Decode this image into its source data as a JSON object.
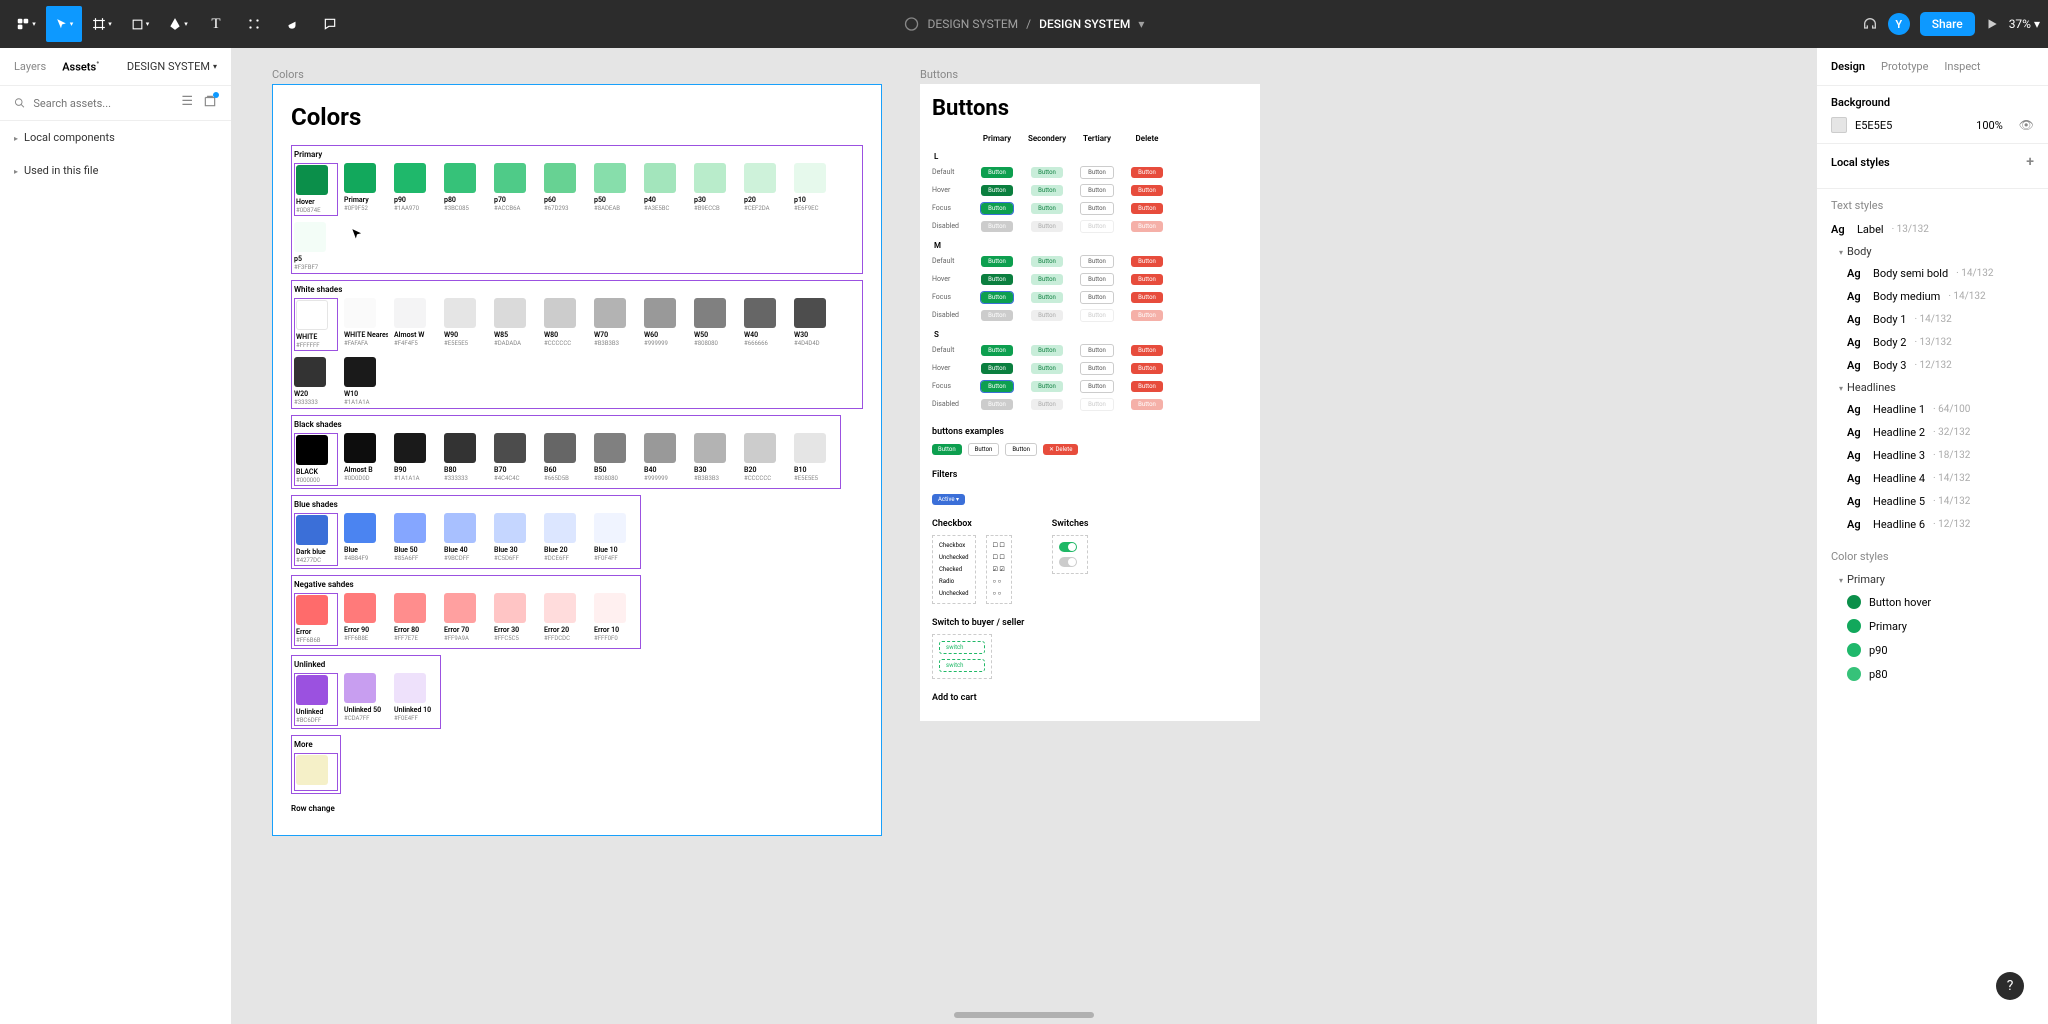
{
  "toolbar": {
    "project": "DESIGN SYSTEM",
    "file": "DESIGN SYSTEM",
    "avatar_letter": "Y",
    "share_label": "Share",
    "zoom": "37%"
  },
  "left_panel": {
    "tabs": {
      "layers": "Layers",
      "assets": "Assets",
      "page": "DESIGN SYSTEM"
    },
    "search_placeholder": "Search assets...",
    "sections": [
      "Local components",
      "Used in this file"
    ]
  },
  "canvas": {
    "colors_frame_label": "Colors",
    "colors_title": "Colors",
    "color_sections": [
      {
        "title": "Primary",
        "swatches": [
          {
            "name": "Hover",
            "hex": "#0D874E",
            "chip": "#0B8F4A"
          },
          {
            "name": "Primary",
            "hex": "#0F9F52",
            "chip": "#12A85C"
          },
          {
            "name": "p90",
            "hex": "#1AA970",
            "chip": "#1FB86B"
          },
          {
            "name": "p80",
            "hex": "#3BC085",
            "chip": "#36C279"
          },
          {
            "name": "p70",
            "hex": "#ACCB6A",
            "chip": "#4FCB88"
          },
          {
            "name": "p60",
            "hex": "#67D293",
            "chip": "#67D293"
          },
          {
            "name": "p50",
            "hex": "#8ADEAB",
            "chip": "#87DEAB"
          },
          {
            "name": "p40",
            "hex": "#A3E5BC",
            "chip": "#A3E5BC"
          },
          {
            "name": "p30",
            "hex": "#B9ECCB",
            "chip": "#B9ECCB"
          },
          {
            "name": "p20",
            "hex": "#CEF2DA",
            "chip": "#CEF2DA"
          },
          {
            "name": "p10",
            "hex": "#E6F9EC",
            "chip": "#E6F9EC"
          },
          {
            "name": "p5",
            "hex": "#F3FBF7",
            "chip": "#F3FDF7"
          }
        ]
      },
      {
        "title": "White shades",
        "swatches": [
          {
            "name": "WHITE",
            "hex": "#FFFFFF",
            "chip": "#FFFFFF"
          },
          {
            "name": "WHITE Nearest",
            "hex": "#FAFAFA",
            "chip": "#FAFAFA"
          },
          {
            "name": "Almost W",
            "hex": "#F4F4F5",
            "chip": "#F4F4F5"
          },
          {
            "name": "W90",
            "hex": "#E5E5E5",
            "chip": "#E5E5E5"
          },
          {
            "name": "W85",
            "hex": "#DADADA",
            "chip": "#DADADA"
          },
          {
            "name": "W80",
            "hex": "#CCCCCC",
            "chip": "#CCCCCC"
          },
          {
            "name": "W70",
            "hex": "#B3B3B3",
            "chip": "#B3B3B3"
          },
          {
            "name": "W60",
            "hex": "#999999",
            "chip": "#999999"
          },
          {
            "name": "W50",
            "hex": "#808080",
            "chip": "#808080"
          },
          {
            "name": "W40",
            "hex": "#666666",
            "chip": "#666666"
          },
          {
            "name": "W30",
            "hex": "#4D4D4D",
            "chip": "#4D4D4D"
          },
          {
            "name": "W20",
            "hex": "#333333",
            "chip": "#333333"
          },
          {
            "name": "W10",
            "hex": "#1A1A1A",
            "chip": "#1A1A1A"
          }
        ]
      },
      {
        "title": "Black shades",
        "swatches": [
          {
            "name": "BLACK",
            "hex": "#000000",
            "chip": "#000000"
          },
          {
            "name": "Almost B",
            "hex": "#0D0D0D",
            "chip": "#0D0D0D"
          },
          {
            "name": "B90",
            "hex": "#1A1A1A",
            "chip": "#1A1A1A"
          },
          {
            "name": "B80",
            "hex": "#333333",
            "chip": "#333333"
          },
          {
            "name": "B70",
            "hex": "#4C4C4C",
            "chip": "#4C4C4C"
          },
          {
            "name": "B60",
            "hex": "#665D5B",
            "chip": "#666666"
          },
          {
            "name": "B50",
            "hex": "#808080",
            "chip": "#808080"
          },
          {
            "name": "B40",
            "hex": "#999999",
            "chip": "#999999"
          },
          {
            "name": "B30",
            "hex": "#B3B3B3",
            "chip": "#B3B3B3"
          },
          {
            "name": "B20",
            "hex": "#CCCCCC",
            "chip": "#CCCCCC"
          },
          {
            "name": "B10",
            "hex": "#E5E5E5",
            "chip": "#E5E5E5"
          }
        ]
      },
      {
        "title": "Blue shades",
        "swatches": [
          {
            "name": "Dark blue",
            "hex": "#4277DC",
            "chip": "#3B6FD8"
          },
          {
            "name": "Blue",
            "hex": "#4B84F9",
            "chip": "#4B84F1"
          },
          {
            "name": "Blue 50",
            "hex": "#85A6FF",
            "chip": "#85A6FF"
          },
          {
            "name": "Blue 40",
            "hex": "#9BCDFF",
            "chip": "#A8C0FF"
          },
          {
            "name": "Blue 30",
            "hex": "#C5D6FF",
            "chip": "#C5D6FF"
          },
          {
            "name": "Blue 20",
            "hex": "#DCE6FF",
            "chip": "#DCE6FF"
          },
          {
            "name": "Blue 10",
            "hex": "#F0F4FF",
            "chip": "#F0F4FF"
          }
        ]
      },
      {
        "title": "Negative sahdes",
        "swatches": [
          {
            "name": "Error",
            "hex": "#FF6B6B",
            "chip": "#FF6B6B"
          },
          {
            "name": "Error 90",
            "hex": "#FF6B8E",
            "chip": "#FF7A7A"
          },
          {
            "name": "Error 80",
            "hex": "#FF7E7E",
            "chip": "#FF8D8D"
          },
          {
            "name": "Error 70",
            "hex": "#FF9A9A",
            "chip": "#FFA0A0"
          },
          {
            "name": "Error 30",
            "hex": "#FFC5C5",
            "chip": "#FFC5C5"
          },
          {
            "name": "Error 20",
            "hex": "#FFDCDC",
            "chip": "#FFDCDC"
          },
          {
            "name": "Error 10",
            "hex": "#FFF0F0",
            "chip": "#FFF0F0"
          }
        ]
      },
      {
        "title": "Unlinked",
        "swatches": [
          {
            "name": "Unlinked",
            "hex": "#BC6DFF",
            "chip": "#9B51E0"
          },
          {
            "name": "Unlinked 50",
            "hex": "#CDA7FF",
            "chip": "#C89EF0"
          },
          {
            "name": "Unlinked 10",
            "hex": "#F0E4FF",
            "chip": "#EEE1FB"
          }
        ]
      },
      {
        "title": "More",
        "swatches": [
          {
            "name": "",
            "hex": "",
            "chip": "#F5F0C8"
          }
        ]
      }
    ],
    "row_change_label": "Row change",
    "buttons_frame_label": "Buttons",
    "buttons_title": "Buttons",
    "button_columns": [
      "Primary",
      "Secondery",
      "Tertiary",
      "Delete"
    ],
    "button_sizes": [
      "L",
      "M",
      "S"
    ],
    "button_states": [
      "Default",
      "Hover",
      "Focus",
      "Disabled"
    ],
    "button_text": "Button",
    "buttons_examples_label": "buttons examples",
    "example_delete": "Delete",
    "filters_label": "Filters",
    "filter_active": "Active",
    "checkbox_label": "Checkbox",
    "switches_label": "Switches",
    "cb_states": [
      "Checkbox",
      "Unchecked",
      "Checked",
      "Radio",
      "Unchecked"
    ],
    "switch_to_label": "Switch to buyer / seller",
    "add_to_cart_label": "Add to cart"
  },
  "right_panel": {
    "tabs": [
      "Design",
      "Prototype",
      "Inspect"
    ],
    "background_label": "Background",
    "bg_hex": "E5E5E5",
    "bg_opacity": "100%",
    "local_styles_label": "Local styles",
    "text_styles_label": "Text styles",
    "text_styles": [
      {
        "name": "Label",
        "meta": "13/132",
        "indent": 0
      },
      {
        "group": "Body"
      },
      {
        "name": "Body semi bold",
        "meta": "14/132",
        "indent": 1
      },
      {
        "name": "Body medium",
        "meta": "14/132",
        "indent": 1
      },
      {
        "name": "Body 1",
        "meta": "14/132",
        "indent": 1
      },
      {
        "name": "Body 2",
        "meta": "13/132",
        "indent": 1
      },
      {
        "name": "Body 3",
        "meta": "12/132",
        "indent": 1
      },
      {
        "group": "Headlines"
      },
      {
        "name": "Headline 1",
        "meta": "64/100",
        "indent": 1
      },
      {
        "name": "Headline 2",
        "meta": "32/132",
        "indent": 1
      },
      {
        "name": "Headline 3",
        "meta": "18/132",
        "indent": 1
      },
      {
        "name": "Headline 4",
        "meta": "14/132",
        "indent": 1
      },
      {
        "name": "Headline 5",
        "meta": "14/132",
        "indent": 1
      },
      {
        "name": "Headline 6",
        "meta": "12/132",
        "indent": 1
      }
    ],
    "color_styles_label": "Color styles",
    "color_group": "Primary",
    "color_styles": [
      {
        "name": "Button hover",
        "chip": "#0B8F4A"
      },
      {
        "name": "Primary",
        "chip": "#12A85C"
      },
      {
        "name": "p90",
        "chip": "#1FB86B"
      },
      {
        "name": "p80",
        "chip": "#36C279"
      }
    ]
  }
}
